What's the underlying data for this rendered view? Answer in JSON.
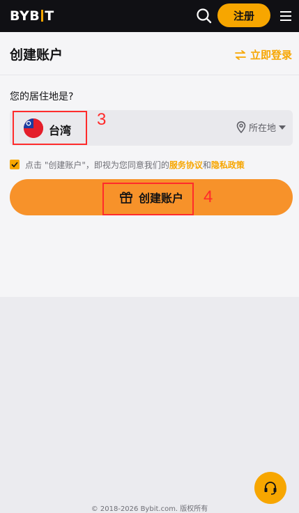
{
  "header": {
    "logo_left": "BYB",
    "logo_right": "T",
    "signup_label": "注册"
  },
  "page": {
    "title": "创建账户",
    "login_label": "立即登录"
  },
  "residence": {
    "question": "您的居住地是?",
    "country": "台湾",
    "location_label": "所在地"
  },
  "agreement": {
    "text_prefix": "点击 \"创建账户\"，即视为您同意我们的",
    "terms_link": "服务协议",
    "conjunction": "和",
    "privacy_link": "隐私政策",
    "checked": true
  },
  "create_button_label": "创建账户",
  "annotations": {
    "country": "3",
    "create": "4"
  },
  "footer": "© 2018-2026 Bybit.com. 版权所有",
  "colors": {
    "accent": "#f7a600",
    "button": "#f7922a",
    "topbar": "#101014",
    "annotation": "#ff2b2b"
  }
}
